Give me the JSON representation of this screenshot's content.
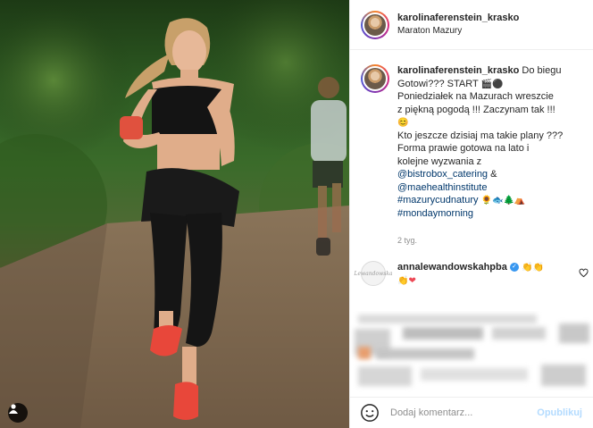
{
  "post": {
    "username": "karolinaferenstein_krasko",
    "location": "Maraton Mazury"
  },
  "caption": {
    "username": "karolinaferenstein_krasko",
    "line1": "Do biegu",
    "line2": "Gotowi??? START",
    "line3": "Poniedziałek na Mazurach wreszcie",
    "line4": "z piękną pogodą !!! Zaczynam tak !!!",
    "line6": "Kto jeszcze dzisiaj ma takie plany ???",
    "line7": "Forma prawie gotowa na lato i",
    "line8": "kolejne wyzwania z",
    "mention1": "@bistrobox_catering",
    "amp": "&",
    "mention2": "@maehealthinstitute",
    "hashtag1": "#mazurycudnatury",
    "hashtag2": "#mondaymorning",
    "time": "2 tyg."
  },
  "comment": {
    "username": "annalewandowskahpba",
    "verified_mark": "✓",
    "avatar_text": "Lewandowska"
  },
  "footer": {
    "placeholder": "Dodaj komentarz...",
    "post_label": "Opublikuj"
  },
  "colors": {
    "link": "#00376b",
    "post_disabled": "#b3dbff",
    "verified": "#3897f0",
    "heart": "#ed4956"
  }
}
